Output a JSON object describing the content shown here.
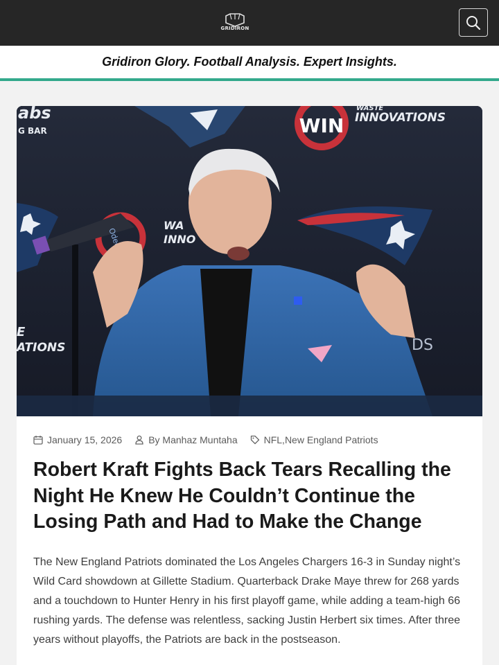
{
  "header": {
    "logo_text": "GRIDIRON",
    "search_icon": "search-icon",
    "colors": {
      "bar": "#262626",
      "accent": "#33a98c"
    }
  },
  "tagline": "Gridiron Glory. Football Analysis. Expert Insights.",
  "article": {
    "image": {
      "description_icon": "press-conference-photo",
      "backdrop_texts": [
        "abs",
        "G BAR",
        "WIN",
        "WASTE",
        "INNOVATIONS",
        "WA",
        "INNO",
        "E",
        "ATIONS",
        "DS",
        "Odeon"
      ]
    },
    "meta": {
      "date": "January 15, 2026",
      "author": "By Manhaz Muntaha",
      "categories": "NFL,New England Patriots"
    },
    "title": "Robert Kraft Fights Back Tears Recalling the Night He Knew He Couldn’t Continue the Losing Path and Had to Make the Change",
    "excerpt": "The New England Patriots dominated the Los Angeles Chargers 16-3 in Sunday night’s Wild Card showdown at Gillette Stadium. Quarterback Drake Maye threw for 268 yards and a touchdown to Hunter Henry in his first playoff game, while adding a team-high 66 rushing yards. The defense was relentless, sacking Justin Herbert six times. After three years without playoffs, the Patriots are back in the postseason."
  }
}
